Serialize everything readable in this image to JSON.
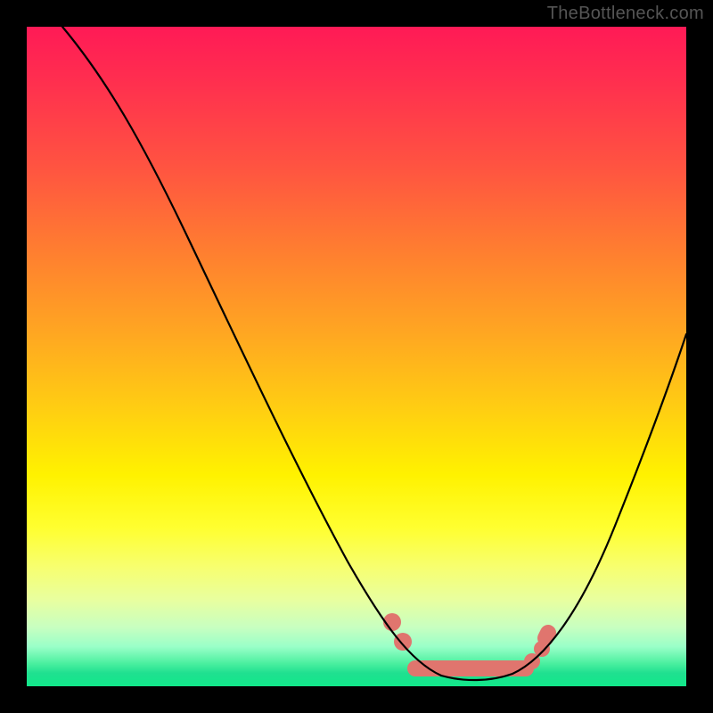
{
  "watermark": "TheBottleneck.com",
  "chart_data": {
    "type": "line",
    "title": "",
    "xlabel": "",
    "ylabel": "",
    "xlim": [
      0,
      100
    ],
    "ylim": [
      0,
      100
    ],
    "grid": false,
    "legend": false,
    "background_gradient": [
      "#ff1a56",
      "#ffa522",
      "#fff200",
      "#12e88a"
    ],
    "series": [
      {
        "name": "bottleneck-curve",
        "x": [
          5,
          12,
          20,
          28,
          36,
          44,
          50,
          56,
          60,
          63,
          68,
          73,
          78,
          84,
          90,
          96,
          100
        ],
        "y": [
          100,
          90,
          78,
          64,
          50,
          34,
          22,
          12,
          6,
          2,
          1,
          1,
          3,
          10,
          24,
          40,
          53
        ]
      }
    ],
    "annotations": {
      "highlight_points_x": [
        55,
        57,
        59,
        76,
        77,
        78
      ],
      "highlight_flat_range_x": [
        59,
        76
      ],
      "highlight_color": "#e0756e"
    }
  }
}
